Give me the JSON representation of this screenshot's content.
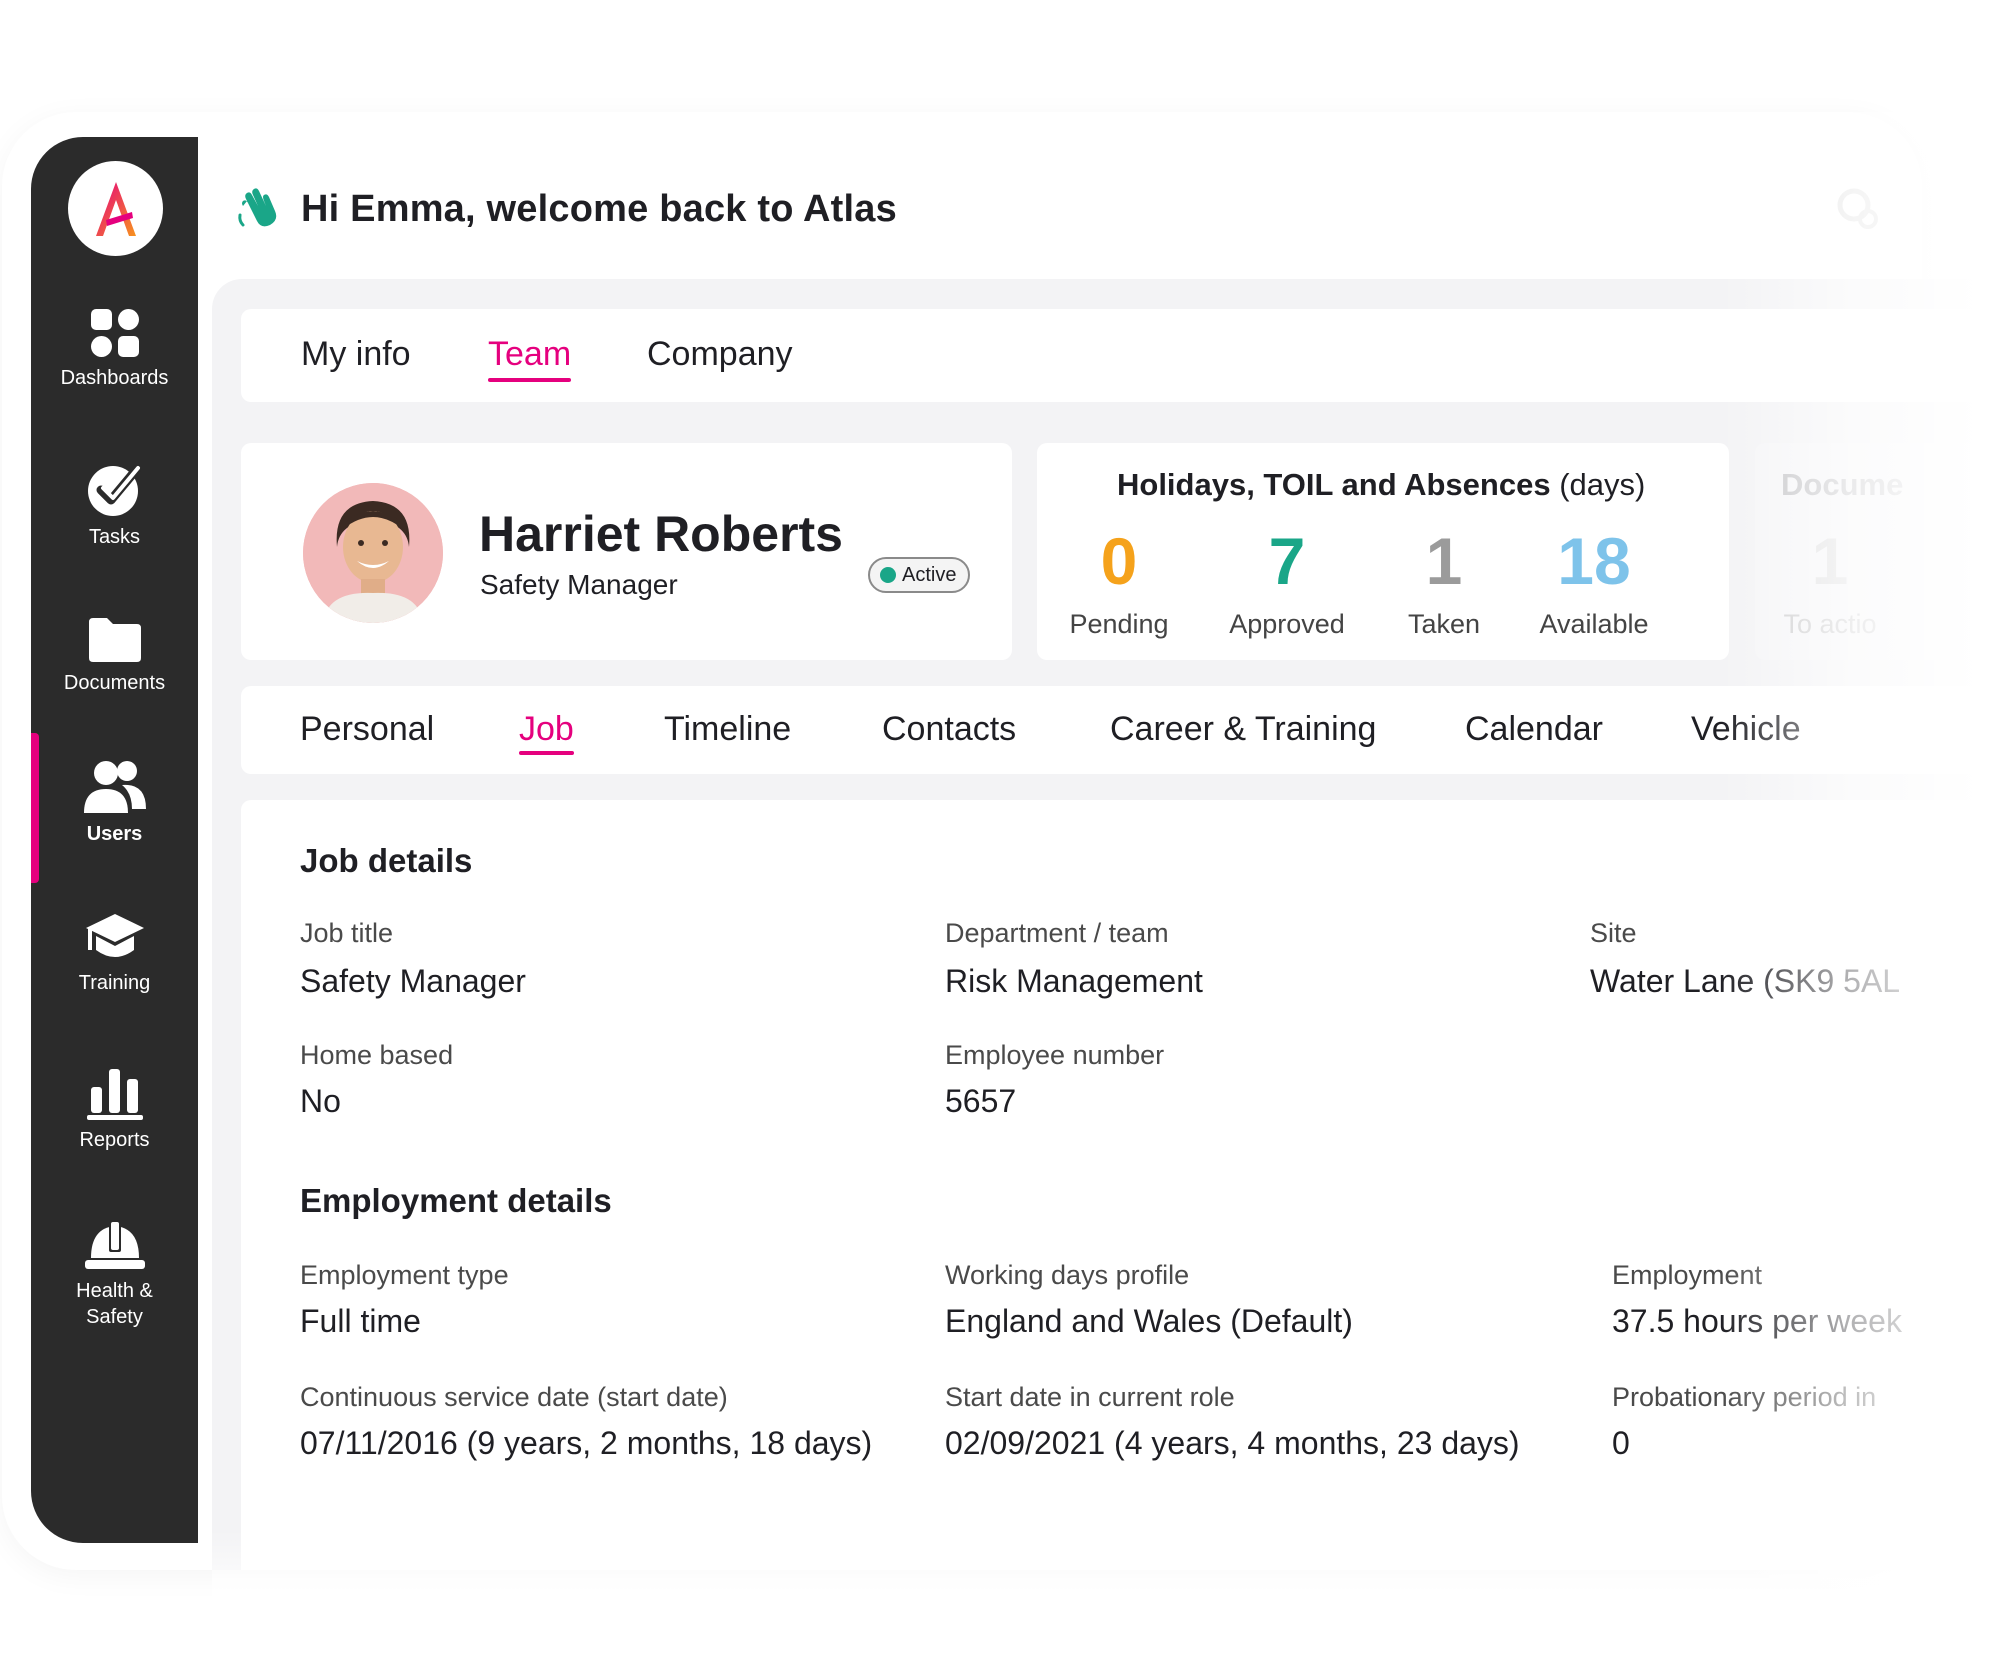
{
  "app": {
    "greeting": "Hi Emma, welcome back to Atlas"
  },
  "sidebar": {
    "items": [
      {
        "label": "Dashboards",
        "icon": "dashboard-grid-icon"
      },
      {
        "label": "Tasks",
        "icon": "check-circle-icon"
      },
      {
        "label": "Documents",
        "icon": "folder-icon"
      },
      {
        "label": "Users",
        "icon": "users-icon",
        "active": true
      },
      {
        "label": "Training",
        "icon": "graduation-cap-icon"
      },
      {
        "label": "Reports",
        "icon": "bar-chart-icon"
      },
      {
        "label": "Health &",
        "label2": "Safety",
        "icon": "hard-hat-icon"
      }
    ]
  },
  "top_tabs": [
    {
      "label": "My info"
    },
    {
      "label": "Team",
      "active": true
    },
    {
      "label": "Company"
    }
  ],
  "profile": {
    "name": "Harriet Roberts",
    "role": "Safety Manager",
    "status": "Active"
  },
  "holidays": {
    "title": "Holidays, TOIL and Absences",
    "unit": "(days)",
    "stats": [
      {
        "value": "0",
        "label": "Pending",
        "color": "#f5a21b"
      },
      {
        "value": "7",
        "label": "Approved",
        "color": "#1aa688"
      },
      {
        "value": "1",
        "label": "Taken",
        "color": "#9b9b9b"
      },
      {
        "value": "18",
        "label": "Available",
        "color": "#7ec3ea"
      }
    ]
  },
  "documents_card": {
    "title": "Docume",
    "value": "1",
    "label": "To actio"
  },
  "sub_tabs": [
    {
      "label": "Personal"
    },
    {
      "label": "Job",
      "active": true
    },
    {
      "label": "Timeline"
    },
    {
      "label": "Contacts"
    },
    {
      "label": "Career & Training"
    },
    {
      "label": "Calendar"
    },
    {
      "label": "Vehicle"
    }
  ],
  "job_details": {
    "title": "Job details",
    "fields": [
      {
        "label": "Job title",
        "value": "Safety Manager"
      },
      {
        "label": "Department / team",
        "value": "Risk Management"
      },
      {
        "label": "Site",
        "value": "Water Lane (SK9 5AL"
      },
      {
        "label": "Home based",
        "value": "No"
      },
      {
        "label": "Employee number",
        "value": "5657"
      }
    ]
  },
  "employment_details": {
    "title": "Employment details",
    "fields": [
      {
        "label": "Employment type",
        "value": "Full time"
      },
      {
        "label": "Working days profile",
        "value": "England and Wales (Default)"
      },
      {
        "label": "Employment",
        "value": "37.5 hours per week"
      },
      {
        "label": "Continuous service date (start date)",
        "value": "07/11/2016 (9 years, 2 months, 18 days)"
      },
      {
        "label": "Start date in current role",
        "value": "02/09/2021 (4 years, 4 months, 23 days)"
      },
      {
        "label": "Probationary period in",
        "value": "0"
      }
    ]
  },
  "colors": {
    "accent": "#e5007e",
    "sidebar": "#2b2b2b",
    "active_status": "#1aa688"
  }
}
